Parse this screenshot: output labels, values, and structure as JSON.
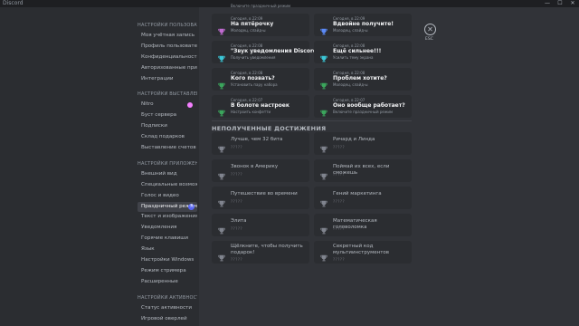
{
  "window": {
    "title": "Discord",
    "controls": [
      "—",
      "☐",
      "✕"
    ]
  },
  "sidebar": {
    "sections": [
      {
        "header": "НАСТРОЙКИ ПОЛЬЗОВАТЕ…",
        "items": [
          {
            "label": "Моя учётная запись"
          },
          {
            "label": "Профиль пользователя"
          },
          {
            "label": "Конфиденциальность"
          },
          {
            "label": "Авторизованные прил…"
          },
          {
            "label": "Интеграции"
          }
        ]
      },
      {
        "header": "НАСТРОЙКИ ВЫСТАВЛЕН…",
        "items": [
          {
            "label": "Nitro"
          },
          {
            "label": "Буст сервера"
          },
          {
            "label": "Подписки"
          },
          {
            "label": "Склад подарков"
          },
          {
            "label": "Выставление счетов"
          }
        ]
      },
      {
        "header": "НАСТРОЙКИ ПРИЛОЖЕНИЯ",
        "items": [
          {
            "label": "Внешний вид"
          },
          {
            "label": "Специальные возмож…"
          },
          {
            "label": "Голос и видео"
          },
          {
            "label": "Праздничный режим"
          },
          {
            "label": "Текст и изображения"
          },
          {
            "label": "Уведомления"
          },
          {
            "label": "Горячие клавиши"
          },
          {
            "label": "Язык"
          },
          {
            "label": "Настройки Windows"
          },
          {
            "label": "Режим стримера"
          },
          {
            "label": "Расширенные"
          }
        ]
      },
      {
        "header": "НАСТРОЙКИ АКТИВНОСТИ",
        "items": [
          {
            "label": "Статус активности"
          },
          {
            "label": "Игровой оверлей"
          }
        ]
      }
    ],
    "selected": "Праздничный режим"
  },
  "close": {
    "icon": "✕",
    "label": "ESC"
  },
  "top_partial_desc": "Включите праздничный режим",
  "unlocked": [
    {
      "date": "Сегодня, в 22:09",
      "name": "На пятёрочку",
      "desc": "Молодец, слайд-ы",
      "color": "#c06bd1"
    },
    {
      "date": "Сегодня, в 22:09",
      "name": "Вдвойне получите!",
      "desc": "Молодец, слайд-ы",
      "color": "#5b8af7"
    },
    {
      "date": "Сегодня, в 22:08",
      "name": "\"Звук уведомления Discord\"",
      "desc": "Получить уведомления",
      "color": "#3bc6d6"
    },
    {
      "date": "Сегодня, в 22:08",
      "name": "Ещё сильнее!!!",
      "desc": "Усилить тему экрана",
      "color": "#3bc6d6"
    },
    {
      "date": "Сегодня, в 22:08",
      "name": "Кого позвать?",
      "desc": "Установить пару набора",
      "color": "#3ba55c"
    },
    {
      "date": "Сегодня, в 22:08",
      "name": "Проблем хотите?",
      "desc": "Молодец, слайд-ы",
      "color": "#3ba55c"
    },
    {
      "date": "Сегодня, в 22:07",
      "name": "В болоте настроек",
      "desc": "Настроить конфетти",
      "color": "#3ba55c"
    },
    {
      "date": "Сегодня, в 22:07",
      "name": "Оно вообще работает?",
      "desc": "Включите праздничный режим",
      "color": "#3ba55c"
    }
  ],
  "locked_title": "НЕПОЛУЧЕННЫЕ ДОСТИЖЕНИЯ",
  "locked": [
    {
      "name": "Лучше, чем 32 бита",
      "stars": "?????"
    },
    {
      "name": "Ричард и Линда",
      "stars": "?????"
    },
    {
      "name": "Звонок в Америку",
      "stars": "?????"
    },
    {
      "name": "Поймай их всех, если сможешь",
      "stars": "?????"
    },
    {
      "name": "Путешествие во времени",
      "stars": "?????"
    },
    {
      "name": "Гений маркетинга",
      "stars": "?????"
    },
    {
      "name": "Элита",
      "stars": "?????"
    },
    {
      "name": "Математическая головоломка",
      "stars": "?????"
    },
    {
      "name": "Щёлкните, чтобы получить подарок!",
      "stars": "?????"
    },
    {
      "name": "Секретный код мультиинструментов",
      "stars": "?????"
    }
  ]
}
